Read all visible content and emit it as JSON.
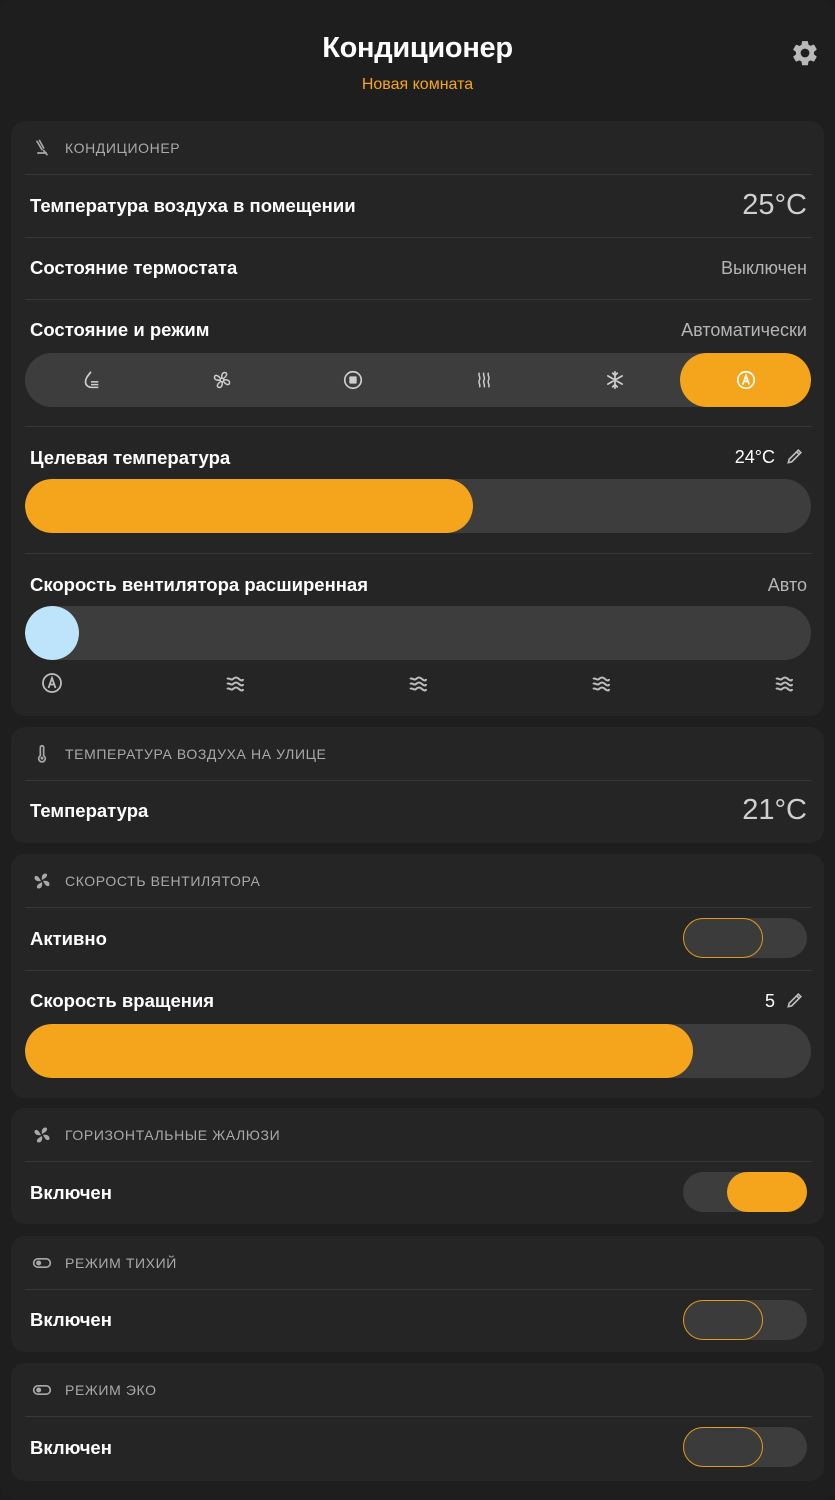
{
  "header": {
    "title": "Кондиционер",
    "subtitle": "Новая комната",
    "settings_icon": "gear-icon"
  },
  "colors": {
    "accent": "#f5a51c",
    "fan_knob": "#bde4fb",
    "card_bg": "#252525",
    "track_bg": "#3d3d3d"
  },
  "ac_card": {
    "heading": "КОНДИЦИОНЕР",
    "heading_icon": "air-conditioner-icon",
    "room_temp_label": "Температура воздуха в помещении",
    "room_temp_value": "25°C",
    "thermostat_label": "Состояние термостата",
    "thermostat_value": "Выключен",
    "mode_label": "Состояние и режим",
    "mode_value": "Автоматически",
    "modes": [
      {
        "icon": "dry-mode-icon",
        "active": false
      },
      {
        "icon": "fan-mode-icon",
        "active": false
      },
      {
        "icon": "off-mode-icon",
        "active": false
      },
      {
        "icon": "heat-mode-icon",
        "active": false
      },
      {
        "icon": "cool-mode-icon",
        "active": false
      },
      {
        "icon": "auto-mode-icon",
        "active": true
      }
    ],
    "target_label": "Целевая температура",
    "target_value": "24°C",
    "target_fill_fraction": 0.57,
    "fan_label": "Скорость вентилятора расширенная",
    "fan_value": "Авто",
    "fan_level_index": 0,
    "fan_ticks": [
      "auto-icon",
      "fan-speed-icon",
      "fan-speed-icon",
      "fan-speed-icon",
      "fan-speed-icon"
    ]
  },
  "outdoor_card": {
    "heading": "ТЕМПЕРАТУРА ВОЗДУХА НА УЛИЦЕ",
    "heading_icon": "thermometer-icon",
    "temp_label": "Температура",
    "temp_value": "21°C"
  },
  "fan_card": {
    "heading": "СКОРОСТЬ ВЕНТИЛЯТОРА",
    "heading_icon": "fan-icon",
    "active_label": "Активно",
    "active_on": false,
    "speed_label": "Скорость вращения",
    "speed_value": "5",
    "speed_fill_fraction": 0.85
  },
  "louvers_card": {
    "heading": "ГОРИЗОНТАЛЬНЫЕ ЖАЛЮЗИ",
    "heading_icon": "fan-icon",
    "label": "Включен",
    "on": true
  },
  "quiet_card": {
    "heading": "РЕЖИМ ТИХИЙ",
    "heading_icon": "toggle-icon",
    "label": "Включен",
    "on": false
  },
  "eco_card": {
    "heading": "РЕЖИМ ЭКО",
    "heading_icon": "toggle-icon",
    "label": "Включен",
    "on": false
  }
}
